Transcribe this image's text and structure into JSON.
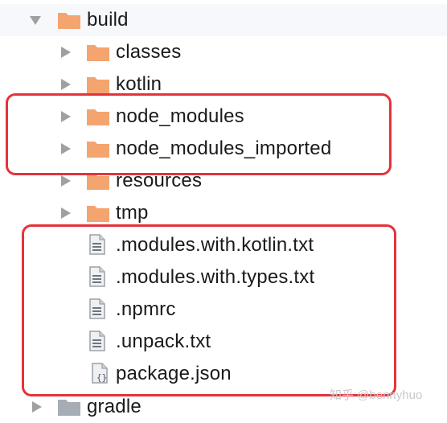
{
  "tree": {
    "build": {
      "label": "build",
      "expanded": true,
      "icon": "folder-icon"
    },
    "children": [
      {
        "label": "classes",
        "type": "folder"
      },
      {
        "label": "kotlin",
        "type": "folder"
      },
      {
        "label": "node_modules",
        "type": "folder",
        "highlighted": true
      },
      {
        "label": "node_modules_imported",
        "type": "folder",
        "highlighted": true
      },
      {
        "label": "resources",
        "type": "folder"
      },
      {
        "label": "tmp",
        "type": "folder"
      },
      {
        "label": ".modules.with.kotlin.txt",
        "type": "text-file",
        "highlighted": true
      },
      {
        "label": ".modules.with.types.txt",
        "type": "text-file",
        "highlighted": true
      },
      {
        "label": ".npmrc",
        "type": "text-file",
        "highlighted": true
      },
      {
        "label": ".unpack.txt",
        "type": "text-file",
        "highlighted": true
      },
      {
        "label": "package.json",
        "type": "json-file",
        "highlighted": true
      }
    ],
    "gradle": {
      "label": "gradle",
      "expanded": false,
      "icon": "folder-icon"
    }
  },
  "watermark": "知乎 @bennyhuo",
  "colors": {
    "folder": "#f4a46f",
    "folder_gray": "#a7adb4",
    "arrow": "#a0a0a0",
    "highlight_border": "#e5323b",
    "row_highlight_bg": "#f6f8fb"
  }
}
